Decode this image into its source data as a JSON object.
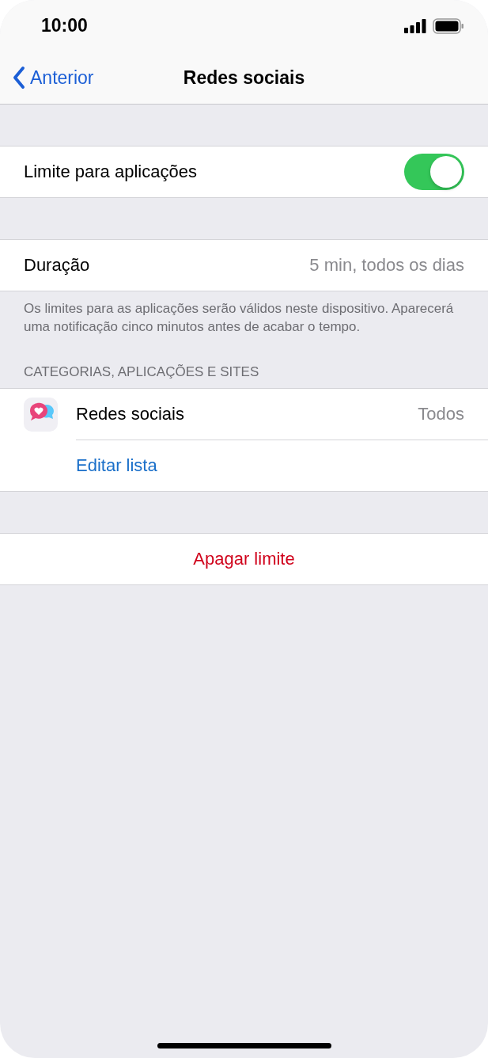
{
  "status_bar": {
    "time": "10:00"
  },
  "nav": {
    "back": "Anterior",
    "title": "Redes sociais"
  },
  "toggle_row": {
    "label": "Limite para aplicações",
    "on": true
  },
  "duration_row": {
    "label": "Duração",
    "value": "5 min, todos os dias"
  },
  "footer_note": "Os limites para as aplicações serão válidos neste dispositivo. Aparecerá uma notificação cinco minutos antes de acabar o tempo.",
  "section_header": "CATEGORIAS, APLICAÇÕES E SITES",
  "category": {
    "label": "Redes sociais",
    "value": "Todos"
  },
  "edit_link": "Editar lista",
  "delete_button": "Apagar limite"
}
